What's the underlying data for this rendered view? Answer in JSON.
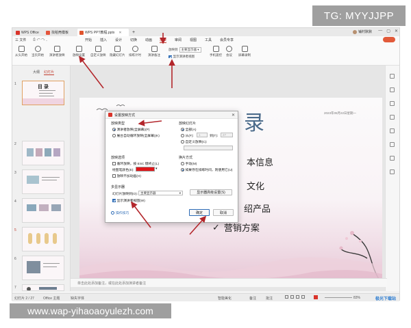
{
  "watermarks": {
    "top": "TG: MYYJJPP",
    "bottom": "www.wap-yihaoaoyulezh.com"
  },
  "titlebar": {
    "tabs": [
      {
        "label": "WPS Office"
      },
      {
        "label": "找稻壳模板"
      },
      {
        "label": "WPS PPT教程.pptx"
      }
    ],
    "add_tab": "+",
    "user": "铺村默默",
    "controls": [
      "—",
      "▢",
      "✕"
    ]
  },
  "menubar": {
    "file": "三 文件",
    "items": [
      "开始",
      "插入",
      "设计",
      "切换",
      "动画",
      "放映",
      "审阅",
      "视图",
      "工具",
      "会员专享"
    ],
    "active_index": 5
  },
  "ribbon": {
    "buttons": [
      "从头开始",
      "当页开始",
      "演讲者放映",
      "放映设置",
      "自定义放映",
      "隐藏幻灯片",
      "排练计时",
      "演讲备注"
    ],
    "monitor_label": "放映到",
    "monitor_value": "主要显示器",
    "presenter_view_label": "显示演讲者视图",
    "extra": [
      "手机遥控",
      "会议",
      "屏幕录制"
    ]
  },
  "leftpanel": {
    "tabs": [
      "大纲",
      "幻灯片"
    ],
    "active_tab": 1,
    "thumb_title": "目 录",
    "slide_numbers": [
      "1",
      "2",
      "3",
      "4",
      "5",
      "6",
      "7"
    ],
    "selected": 0,
    "add_label": "+"
  },
  "slide": {
    "date": "2023年05月22日星期一",
    "title_char": "录",
    "items": [
      "本信息",
      "文化",
      "绍产品",
      "营销方案"
    ],
    "check": "✓"
  },
  "dialog": {
    "title": "设置放映方式",
    "close": "✕",
    "type_title": "放映类型",
    "type_options": [
      "演讲者放映(全屏幕)(P)",
      "展台自动循环放映(全屏幕)(K)"
    ],
    "type_selected": 0,
    "slides_title": "放映幻灯片",
    "slides_all": "全部(A)",
    "slides_from": "从(F):",
    "slides_from_value": "1",
    "slides_to": "到(T):",
    "slides_to_value": "27",
    "slides_custom": "自定义放映(C):",
    "options_title": "放映选项",
    "loop_label": "循环放映，按 ESC 键终止(L)",
    "pen_color_label": "绘图笔颜色(E):",
    "pen_color": "#e0161b",
    "no_anim_label": "放映不加动画(H)",
    "advance_title": "换片方式",
    "advance_manual": "手动(M)",
    "advance_timing": "如果存在排练时间，则使用它(U)",
    "multi_title": "多显示器",
    "monitor_label": "幻灯片放映到(O):",
    "monitor_value": "主要显示器",
    "display_settings_btn": "显示器高级设置(S)",
    "presenter_view_label": "显示演讲者视图(W)",
    "tips_label": "操作技巧",
    "ok": "确定",
    "cancel": "取消"
  },
  "notes_placeholder": "单击此处添加备注，或在此处添加演讲者备注",
  "statusbar": {
    "slide_info": "幻灯片 2 / 27",
    "theme": "Office 主题",
    "font_missing": "缺失字体",
    "smart_beautify": "智能美化",
    "notes": "备注",
    "comments": "批注",
    "zoom": "83%"
  },
  "site_logo": "极光下载站",
  "colors": {
    "accent": "#c0392b",
    "arrow": "#b3262b",
    "pen": "#e0161b"
  }
}
